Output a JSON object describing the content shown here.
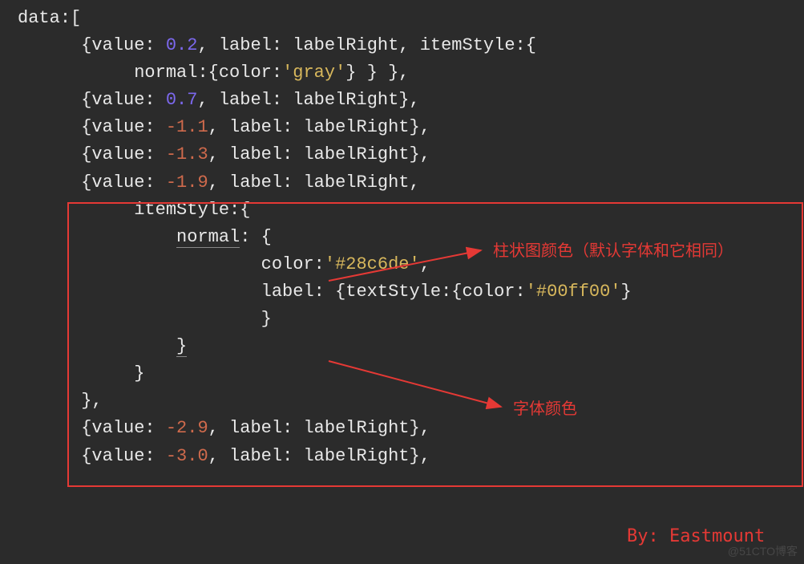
{
  "code": {
    "l1a": "data",
    "l1b": ":[",
    "l2a": "{value: ",
    "l2v": "0.2",
    "l2b": ", label: labelRight, itemStyle:{",
    "l3a": "normal:{color:",
    "l3s": "'gray'",
    "l3b": "} } },",
    "l4a": "{value: ",
    "l4v": "0.7",
    "l4b": ", label: labelRight},",
    "l5a": "{value: ",
    "l5v": "-1.1",
    "l5b": ", label: labelRight},",
    "l6a": "{value: ",
    "l6v": "-1.3",
    "l6b": ", label: labelRight},",
    "l7a": "{value: ",
    "l7v": "-1.9",
    "l7b": ", label: labelRight,",
    "l8": "itemStyle:{",
    "l9a": "normal",
    "l9b": ": {",
    "l10a": "color:",
    "l10s": "'#28c6de'",
    "l10b": ",",
    "l11a": "label: {textStyle:{color:",
    "l11s": "'#00ff00'",
    "l11b": "}",
    "l12": "}",
    "l13": "}",
    "l14": "}",
    "l15": "},",
    "l16a": "{value: ",
    "l16v": "-2.9",
    "l16b": ", label: labelRight},",
    "l17a": "{value: ",
    "l17v": "-3.0",
    "l17b": ", label: labelRight},"
  },
  "annotations": {
    "bar_color": "柱状图颜色（默认字体和它相同）",
    "font_color": "字体颜色",
    "credit": "By: Eastmount"
  },
  "watermark": "@51CTO博客"
}
